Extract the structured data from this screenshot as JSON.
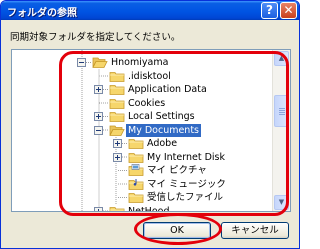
{
  "window": {
    "title": "フォルダの参照",
    "help_label": "?",
    "close_label": "✕"
  },
  "instruction": "同期対象フォルダを指定してください。",
  "tree": {
    "items": [
      {
        "label": "Hnomiyama",
        "icon": "folder-open-icon",
        "expander": "minus",
        "selected": false
      },
      {
        "label": ".idisktool",
        "icon": "folder-icon",
        "expander": "none",
        "selected": false
      },
      {
        "label": "Application Data",
        "icon": "folder-icon",
        "expander": "plus",
        "selected": false
      },
      {
        "label": "Cookies",
        "icon": "folder-icon",
        "expander": "none",
        "selected": false
      },
      {
        "label": "Local Settings",
        "icon": "folder-icon",
        "expander": "plus",
        "selected": false
      },
      {
        "label": "My Documents",
        "icon": "folder-open-icon",
        "expander": "minus",
        "selected": true
      },
      {
        "label": "Adobe",
        "icon": "folder-icon",
        "expander": "plus",
        "selected": false
      },
      {
        "label": "My Internet Disk",
        "icon": "folder-icon",
        "expander": "plus",
        "selected": false
      },
      {
        "label": "マイ ピクチャ",
        "icon": "pictures-folder-icon",
        "expander": "none",
        "selected": false
      },
      {
        "label": "マイ ミュージック",
        "icon": "music-folder-icon",
        "expander": "none",
        "selected": false
      },
      {
        "label": "受信したファイル",
        "icon": "folder-icon",
        "expander": "none",
        "selected": false
      },
      {
        "label": "NetHood",
        "icon": "folder-icon",
        "expander": "plus",
        "selected": false
      }
    ]
  },
  "scrollbar": {
    "up_icon": "scroll-up-arrow-icon",
    "down_icon": "scroll-down-arrow-icon"
  },
  "buttons": {
    "ok_label": "OK",
    "cancel_label": "キャンセル"
  },
  "colors": {
    "highlight": "#e3000b",
    "selection": "#316ac5",
    "titlebar": "#0054e3"
  }
}
